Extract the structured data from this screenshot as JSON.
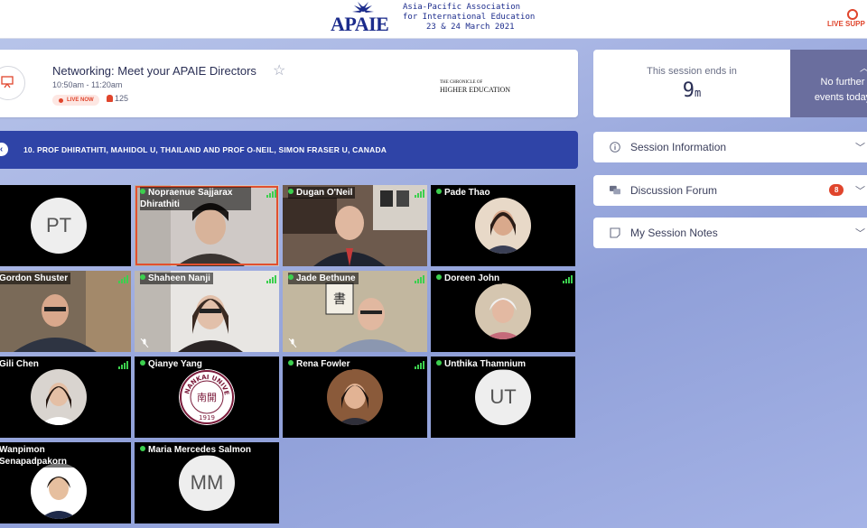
{
  "header": {
    "logo_text": "APAIE",
    "association_line1": "Asia-Pacific Association",
    "association_line2": "for International Education",
    "dates": "23 & 24 March 2021",
    "live_support": "LIVE SUPP"
  },
  "session": {
    "title": "Networking: Meet your APAIE Directors",
    "time": "10:50am - 11:20am",
    "live_label": "LIVE NOW",
    "viewer_count": "125",
    "sponsor_line1": "THE CHRONICLE OF",
    "sponsor_line2": "HIGHER EDUCATION"
  },
  "ends": {
    "label": "This session ends in",
    "value": "9",
    "unit": "m"
  },
  "further": {
    "line1": "No further",
    "line2": "events today"
  },
  "room_banner": {
    "text": "10. PROF DHIRATHITI, MAHIDOL U, THAILAND AND PROF O-NEIL, SIMON FRASER U, CANADA"
  },
  "panels": {
    "info": "Session Information",
    "forum": "Discussion Forum",
    "forum_badge": "8",
    "notes": "My Session Notes"
  },
  "participants": [
    {
      "name": "",
      "initials": "PT"
    },
    {
      "name": "Nopraenue Sajjarax Dhirathiti"
    },
    {
      "name": "Dugan O'Neil"
    },
    {
      "name": "Pade Thao"
    },
    {
      "name": "Gordon Shuster"
    },
    {
      "name": "Shaheen Nanji"
    },
    {
      "name": "Jade Bethune"
    },
    {
      "name": "Doreen John"
    },
    {
      "name": "Gili Chen"
    },
    {
      "name": "Qianye Yang",
      "seal_text": "NANKAI UNIVERSITY",
      "seal_year": "1919",
      "seal_glyphs": "南開"
    },
    {
      "name": "Rena Fowler"
    },
    {
      "name": "Unthika Thamnium",
      "initials": "UT"
    },
    {
      "name": "Wanpimon Senapadpakorn"
    },
    {
      "name": "Maria Mercedes Salmon",
      "initials": "MM"
    }
  ],
  "colors": {
    "accent_red": "#e0452c",
    "banner_blue": "#2f44a7",
    "online_green": "#3ccf4e"
  }
}
